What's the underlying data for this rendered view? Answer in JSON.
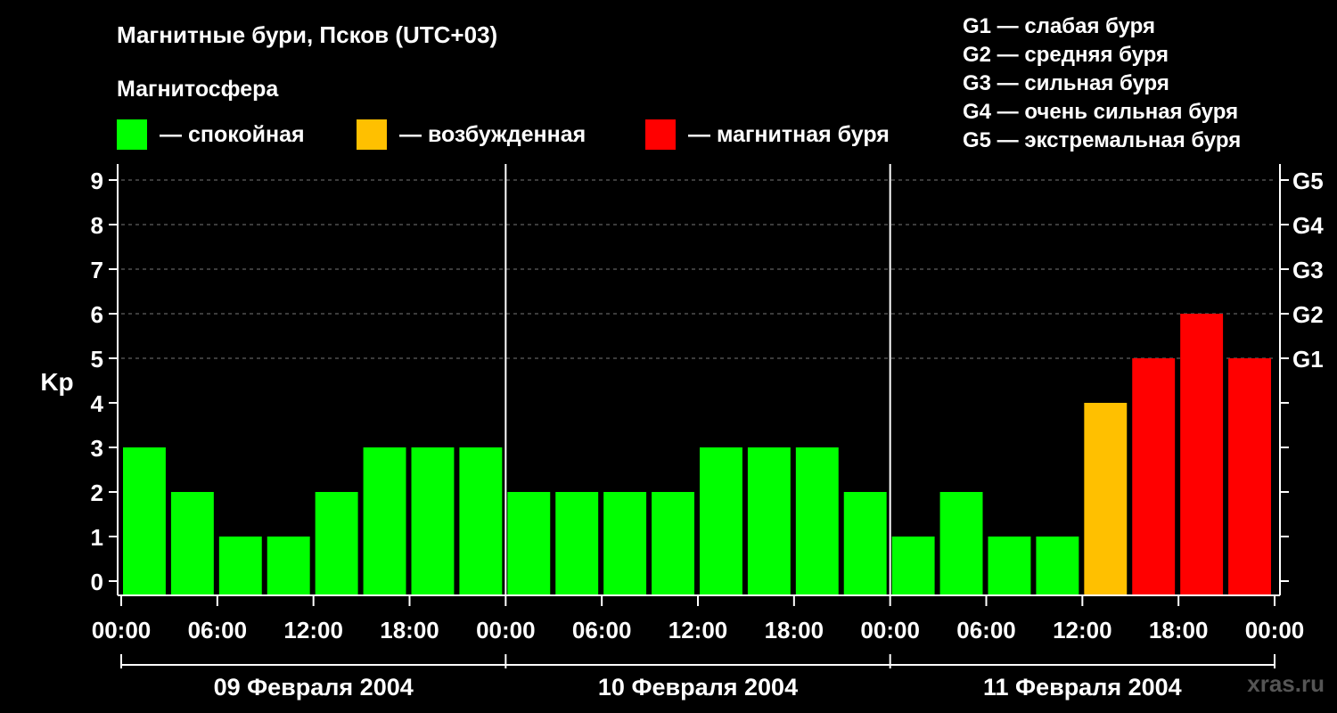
{
  "chart_data": {
    "type": "bar",
    "title": "Магнитные бури, Псков (UTC+03)",
    "subtitle": "Магнитосфера",
    "ylabel": "Kp",
    "ylim": [
      0,
      9
    ],
    "yticks": [
      "0",
      "1",
      "2",
      "3",
      "4",
      "5",
      "6",
      "7",
      "8",
      "9"
    ],
    "storm_ticks": [
      {
        "kp": 5,
        "label": "G1"
      },
      {
        "kp": 6,
        "label": "G2"
      },
      {
        "kp": 7,
        "label": "G3"
      },
      {
        "kp": 8,
        "label": "G4"
      },
      {
        "kp": 9,
        "label": "G5"
      }
    ],
    "xticks": [
      "00:00",
      "06:00",
      "12:00",
      "18:00",
      "00:00",
      "06:00",
      "12:00",
      "18:00",
      "00:00",
      "06:00",
      "12:00",
      "18:00",
      "00:00"
    ],
    "days": [
      "09 Февраля 2004",
      "10 Февраля 2004",
      "11 Февраля 2004"
    ],
    "interval_hours": 3,
    "values": [
      3,
      2,
      1,
      1,
      2,
      3,
      3,
      3,
      2,
      2,
      2,
      2,
      3,
      3,
      3,
      2,
      1,
      2,
      1,
      1,
      4,
      5,
      6,
      5
    ],
    "legend": [
      {
        "label": "— спокойная",
        "color": "#00ff00"
      },
      {
        "label": "— возбужденная",
        "color": "#ffc000"
      },
      {
        "label": "— магнитная буря",
        "color": "#ff0000"
      }
    ],
    "storm_levels": [
      "G1 — слабая буря",
      "G2 — средняя буря",
      "G3 — сильная буря",
      "G4 — очень сильная буря",
      "G5 — экстремальная буря"
    ],
    "grid": "dashed horizontal",
    "watermark": "xras.ru"
  }
}
